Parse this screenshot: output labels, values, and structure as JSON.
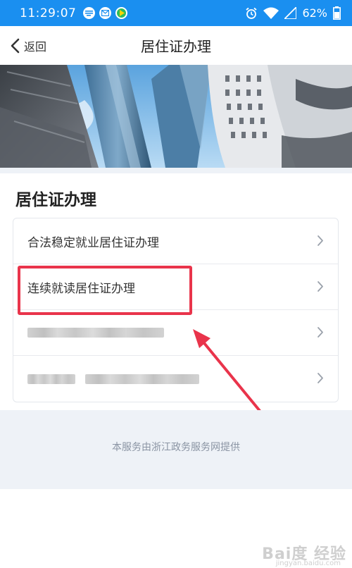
{
  "status_bar": {
    "time": "11:29:07",
    "battery_percent": "62%",
    "icons": [
      "message-icon",
      "mail-icon",
      "play-icon",
      "alarm-icon",
      "wifi-icon",
      "signal-icon",
      "battery-icon"
    ]
  },
  "nav": {
    "back_label": "返回",
    "title": "居住证办理"
  },
  "section": {
    "title": "居住证办理",
    "items": [
      {
        "label": "合法稳定就业居住证办理",
        "blurred": false
      },
      {
        "label": "连续就读居住证办理",
        "blurred": false
      },
      {
        "label": "",
        "blurred": true
      },
      {
        "label": "",
        "blurred": true
      }
    ]
  },
  "footer": {
    "text": "本服务由浙江政务服务网提供"
  },
  "watermark": {
    "main": "Bai度 经验",
    "sub": "jingyan.baidu.com"
  },
  "colors": {
    "status_bar": "#1a8ff0",
    "annotation": "#e9344b",
    "footer_bg": "#eef2f7"
  }
}
